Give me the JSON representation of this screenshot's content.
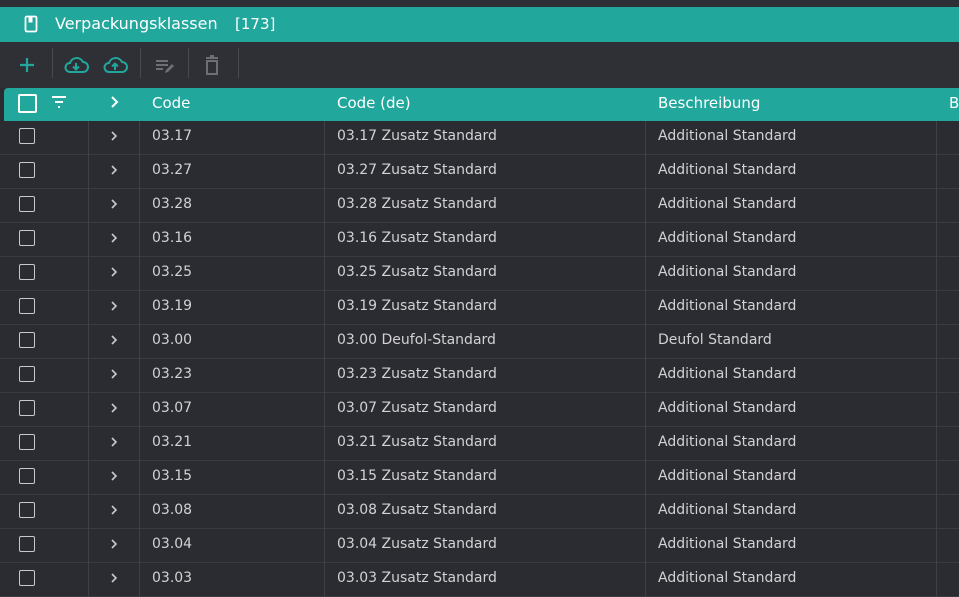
{
  "window": {
    "title": "Verpackungsklassen",
    "count": "[173]"
  },
  "toolbar": {
    "add": "plus-icon",
    "import": "cloud-download-icon",
    "export": "cloud-upload-icon",
    "edit": "edit-list-icon",
    "delete": "trash-icon"
  },
  "colors": {
    "accent": "#21a79c",
    "background": "#2b2c31"
  },
  "table": {
    "headers": {
      "code": "Code",
      "code_de": "Code (de)",
      "beschreibung": "Beschreibung",
      "next": "B"
    },
    "rows": [
      {
        "code": "03.17",
        "code_de": "03.17 Zusatz Standard",
        "beschreibung": "Additional Standard"
      },
      {
        "code": "03.27",
        "code_de": "03.27 Zusatz Standard",
        "beschreibung": "Additional Standard"
      },
      {
        "code": "03.28",
        "code_de": "03.28 Zusatz Standard",
        "beschreibung": "Additional Standard"
      },
      {
        "code": "03.16",
        "code_de": "03.16 Zusatz Standard",
        "beschreibung": "Additional Standard"
      },
      {
        "code": "03.25",
        "code_de": "03.25 Zusatz Standard",
        "beschreibung": "Additional Standard"
      },
      {
        "code": "03.19",
        "code_de": "03.19 Zusatz Standard",
        "beschreibung": "Additional Standard"
      },
      {
        "code": "03.00",
        "code_de": "03.00 Deufol-Standard",
        "beschreibung": "Deufol Standard"
      },
      {
        "code": "03.23",
        "code_de": "03.23 Zusatz Standard",
        "beschreibung": "Additional Standard"
      },
      {
        "code": "03.07",
        "code_de": "03.07 Zusatz Standard",
        "beschreibung": "Additional Standard"
      },
      {
        "code": "03.21",
        "code_de": "03.21 Zusatz Standard",
        "beschreibung": "Additional Standard"
      },
      {
        "code": "03.15",
        "code_de": "03.15 Zusatz Standard",
        "beschreibung": "Additional Standard"
      },
      {
        "code": "03.08",
        "code_de": "03.08 Zusatz Standard",
        "beschreibung": "Additional Standard"
      },
      {
        "code": "03.04",
        "code_de": "03.04 Zusatz Standard",
        "beschreibung": "Additional Standard"
      },
      {
        "code": "03.03",
        "code_de": "03.03 Zusatz Standard",
        "beschreibung": "Additional Standard"
      }
    ]
  }
}
